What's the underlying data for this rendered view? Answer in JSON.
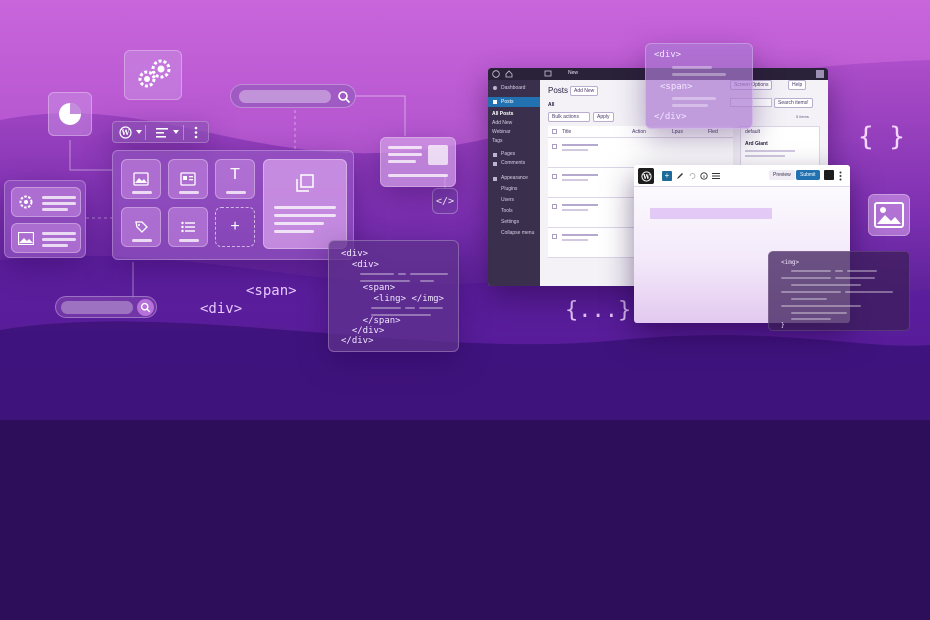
{
  "colors": {
    "accent": "#7b2fb0",
    "wp_blue": "#2271b1",
    "wp_sidebar": "#3a2f4c"
  },
  "block_panel": {
    "tiles": [
      {
        "icon": "image-icon"
      },
      {
        "icon": "media-text-icon"
      },
      {
        "icon": "text-icon",
        "glyph": "T"
      },
      {
        "icon": "tag-icon"
      },
      {
        "icon": "list-icon"
      },
      {
        "icon": "add-icon",
        "glyph": "+"
      }
    ]
  },
  "toolbar_icons": [
    "wordpress-icon",
    "align-icon",
    "more-icon"
  ],
  "floating_tags": {
    "span": "<span>",
    "div": "<div>",
    "braces": "{ }",
    "ellipsis_braces": "{...}",
    "code_icon": "</>"
  },
  "code_block_1": {
    "lines": [
      "<div>",
      "  <div>",
      "",
      "",
      "    <span>",
      "      <ling> </img>",
      "",
      "    </span>",
      "  </div>",
      "</div>"
    ]
  },
  "code_block_2": {
    "lines": [
      "<div>",
      "",
      "",
      "<span>",
      "",
      "",
      "</div>"
    ]
  },
  "code_block_3": {
    "first": "<img>",
    "last": "}"
  },
  "wp_admin": {
    "menu": [
      "Dashboard",
      "Posts",
      "All Posts",
      "Add New",
      "Webinar",
      "Tags",
      "Pages",
      "Comments",
      "Appearance",
      "Plugins",
      "Users",
      "Tools",
      "Settings",
      "Collapse menu"
    ],
    "page_title": "Posts",
    "add_new": "Add New",
    "filter_all": "All",
    "bulk_actions": "Bulk actions",
    "apply": "Apply",
    "screen_options": "Screen Options",
    "help": "Help",
    "search_button": "Search items!",
    "items_count": "5 items",
    "columns": [
      "Title",
      "Action",
      "Lpus",
      "Fled",
      "default"
    ],
    "sidebar_card_title": "Ard Giant",
    "topbar_new": "New"
  },
  "editor": {
    "preview": "Preview",
    "publish": "Submit"
  }
}
